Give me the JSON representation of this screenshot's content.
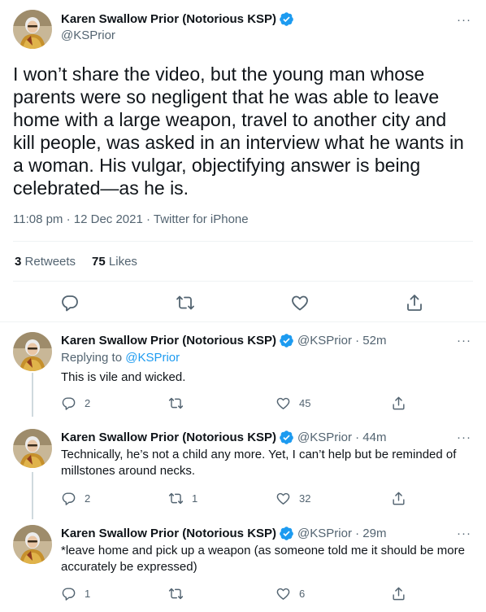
{
  "main_tweet": {
    "author_name": "Karen Swallow Prior (Notorious KSP)",
    "handle": "@KSPrior",
    "text": "I won’t share the video, but the young man whose parents were so negligent that he was able to leave home with a large weapon, travel to another city and kill people, was asked in an interview what he wants in a woman. His vulgar, objectifying answer is being celebrated—as he is.",
    "timestamp": "11:08 pm · 12 Dec 2021 · Twitter for iPhone",
    "retweets_count": "3",
    "retweets_label": "Retweets",
    "likes_count": "75",
    "likes_label": "Likes",
    "more_label": "···"
  },
  "replies": [
    {
      "author_name": "Karen Swallow Prior (Notorious KSP)",
      "handle_time": "@KSPrior · 52m",
      "replying_prefix": "Replying to ",
      "replying_handle": "@KSPrior",
      "text": "This is vile and wicked.",
      "reply_count": "2",
      "retweet_count": "",
      "like_count": "45",
      "more_label": "···"
    },
    {
      "author_name": "Karen Swallow Prior (Notorious KSP)",
      "handle_time": "@KSPrior · 44m",
      "text": "Technically, he’s not a child any more. Yet, I can’t help but be reminded of millstones around necks.",
      "reply_count": "2",
      "retweet_count": "1",
      "like_count": "32",
      "more_label": "···"
    },
    {
      "author_name": "Karen Swallow Prior (Notorious KSP)",
      "handle_time": "@KSPrior · 29m",
      "text": "*leave home and pick up a weapon (as someone told me it should be more accurately be expressed)",
      "reply_count": "1",
      "retweet_count": "",
      "like_count": "6",
      "more_label": "···"
    }
  ],
  "icons": {
    "verified": "verified-badge-icon",
    "reply": "reply-icon",
    "retweet": "retweet-icon",
    "like": "heart-icon",
    "share": "share-icon"
  },
  "colors": {
    "accent": "#1d9bf0",
    "text": "#0f1419",
    "secondary": "#536471",
    "divider": "#eff3f4"
  }
}
